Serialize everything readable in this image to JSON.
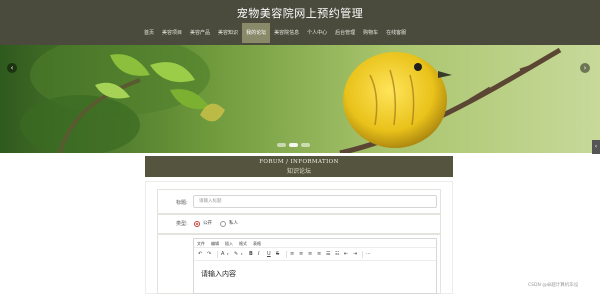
{
  "header": {
    "title": "宠物美容院网上预约管理"
  },
  "nav": {
    "items": [
      "首页",
      "美容项目",
      "美容产品",
      "美容知识",
      "我的论坛",
      "美容院信息",
      "个人中心",
      "后台管理",
      "购物车",
      "在线客服"
    ],
    "active_index": 4
  },
  "banner": {
    "left_arrow": "‹",
    "right_arrow": "›",
    "slide_count": 3,
    "active_slide": 1
  },
  "side_tab": {
    "label": "‹"
  },
  "forum": {
    "title_en": "FORUM / INFORMATION",
    "title_cn": "知识论坛"
  },
  "form": {
    "title_label": "标题:",
    "title_placeholder": "请输入标题",
    "type_label": "类型:",
    "type_options": [
      "公开",
      "私人"
    ],
    "type_selected": "公开",
    "editor_menus": [
      "文件",
      "编辑",
      "插入",
      "格式",
      "表格"
    ],
    "editor_placeholder": "请输入内容"
  },
  "colors": {
    "header_bg": "#4a4a3d",
    "nav_active": "#8a8a6a",
    "forum_head_bg": "#55553f",
    "radio_accent": "#c43b3b"
  },
  "watermark": "CSDN @卓越计算机毕设"
}
